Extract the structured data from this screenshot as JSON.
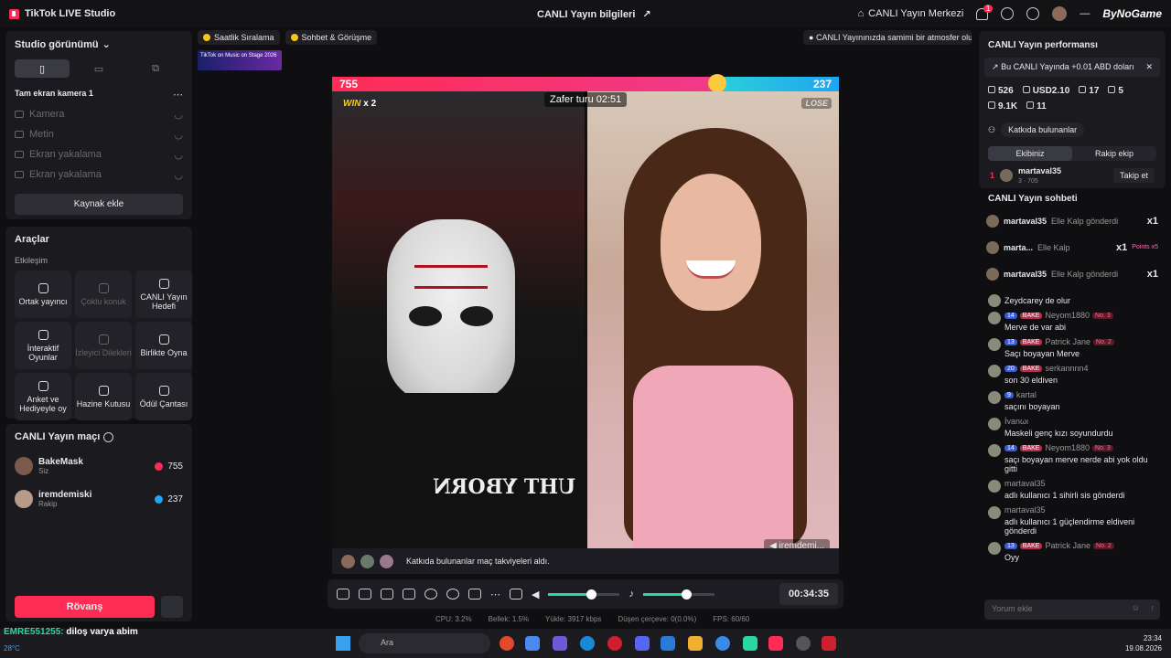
{
  "titlebar": {
    "app_name": "TikTok LIVE Studio",
    "center_title": "CANLI Yayın bilgileri",
    "live_center": "CANLI Yayın Merkezi",
    "notif_count": "1",
    "watermark": "ByNoGame"
  },
  "left": {
    "studio_view": "Studio görünümü",
    "camera_section": "Tam ekran kamera 1",
    "sources": [
      "Kamera",
      "Metin",
      "Ekran yakalama",
      "Ekran yakalama"
    ],
    "add_source": "Kaynak ekle",
    "tools_title": "Araçlar",
    "interaction_label": "Etkileşim",
    "tools": [
      {
        "label": "Ortak yayıncı",
        "enabled": true
      },
      {
        "label": "Çoklu konuk",
        "enabled": false
      },
      {
        "label": "CANLI Yayın Hedefi",
        "enabled": true
      },
      {
        "label": "İnteraktif Oyunlar",
        "enabled": true
      },
      {
        "label": "İzleyici Dilekleri",
        "enabled": false
      },
      {
        "label": "Birlikte Oyna",
        "enabled": true
      },
      {
        "label": "Anket ve Hediyeyle oy",
        "enabled": true
      },
      {
        "label": "Hazine Kutusu",
        "enabled": true
      },
      {
        "label": "Ödül Çantası",
        "enabled": true
      }
    ],
    "match_title": "CANLI Yayın maçı",
    "players": [
      {
        "name": "BakeMask",
        "role": "Siz",
        "score": "755"
      },
      {
        "name": "iremdemiski",
        "role": "Rakip",
        "score": "237"
      }
    ],
    "rematch": "Rövanş"
  },
  "center": {
    "chips": [
      "Saatlik Sıralama",
      "Sohbet & Görüşme"
    ],
    "tip": "CANLI Yayınınızda samimi bir atmosfer olu...",
    "banner_text": "TikTok on Music on Stage 2026",
    "score_left": "755",
    "score_right": "237",
    "score_left_fraction": 0.76,
    "win_label": "WIN",
    "win_mult": "x 2",
    "lose_label": "LOSE",
    "round_timer": "Zafer turu 02:51",
    "opponent_tag": "iremdemi...",
    "shirt_text": "UHT YBORN",
    "contrib_msg": "Katkıda bulunanlar maç takviyeleri aldı.",
    "volume_level": 0.6,
    "mic_level": 0.6,
    "elapsed": "00:34:35",
    "stats": [
      "CPU: 3.2%",
      "Bellek: 1.5%",
      "Yükle: 3917 kbps",
      "Düşen çerçeve: 0(0.0%)",
      "FPS: 60/60"
    ]
  },
  "right": {
    "perf_title": "CANLI Yayın performansı",
    "perf_note": "Bu CANLI Yayında +0.01 ABD doları",
    "metrics": [
      "526",
      "USD2.10",
      "17",
      "5",
      "9.1K",
      "11"
    ],
    "contributors": "Katkıda bulunanlar",
    "team_tabs": [
      "Ekibiniz",
      "Rakip ekip"
    ],
    "top_contributor": {
      "rank": "1",
      "name": "martaval35",
      "sub": "3 · 705",
      "follow": "Takip et"
    },
    "chat_title": "CANLI Yayın sohbeti",
    "gifts": [
      {
        "user": "martaval35",
        "text": "Elle Kalp gönderdi",
        "count": "x1",
        "extra": ""
      },
      {
        "user": "marta...",
        "text": "Elle Kalp",
        "count": "x1",
        "extra": "Points x5"
      },
      {
        "user": "martaval35",
        "text": "Elle Kalp gönderdi",
        "count": "x1",
        "extra": ""
      }
    ],
    "messages": [
      {
        "level": "",
        "fan": "",
        "user": "",
        "rank": "",
        "text": "Zeydcarey de olur"
      },
      {
        "level": "14",
        "fan": "BAKE",
        "user": "Neyom1880",
        "rank": "No. 3",
        "text": "Merve de var abi"
      },
      {
        "level": "13",
        "fan": "BAKE",
        "user": "Patrick Jane",
        "rank": "No. 2",
        "text": "Saçı boyayan Merve"
      },
      {
        "level": "20",
        "fan": "BAKE",
        "user": "serkannnn4",
        "rank": "",
        "text": "son 30 eldiven"
      },
      {
        "level": "9",
        "fan": "",
        "user": "kartal",
        "rank": "",
        "text": "saçını boyayan"
      },
      {
        "level": "",
        "fan": "",
        "user": "İvanωι",
        "rank": "",
        "text": "Maskeli genç kızı soyundurdu"
      },
      {
        "level": "14",
        "fan": "BAKE",
        "user": "Neyom1880",
        "rank": "No. 3",
        "text": "saçı boyayan merve nerde abi yok oldu gitti"
      },
      {
        "level": "",
        "fan": "",
        "user": "martaval35",
        "rank": "",
        "text": "adlı kullanıcı 1 sihirli sis gönderdi"
      },
      {
        "level": "",
        "fan": "",
        "user": "martaval35",
        "rank": "",
        "text": "adlı kullanıcı 1 güçlendirme eldiveni gönderdi"
      },
      {
        "level": "13",
        "fan": "BAKE",
        "user": "Patrick Jane",
        "rank": "No. 2",
        "text": "Oyy"
      }
    ],
    "comment_placeholder": "Yorum ekle"
  },
  "overlay": {
    "user": "EMRE551255:",
    "text": "diloş varya abim",
    "weather": "28°C"
  },
  "taskbar": {
    "search": "Ara",
    "time": "23:34",
    "date": "19.08.2026"
  }
}
